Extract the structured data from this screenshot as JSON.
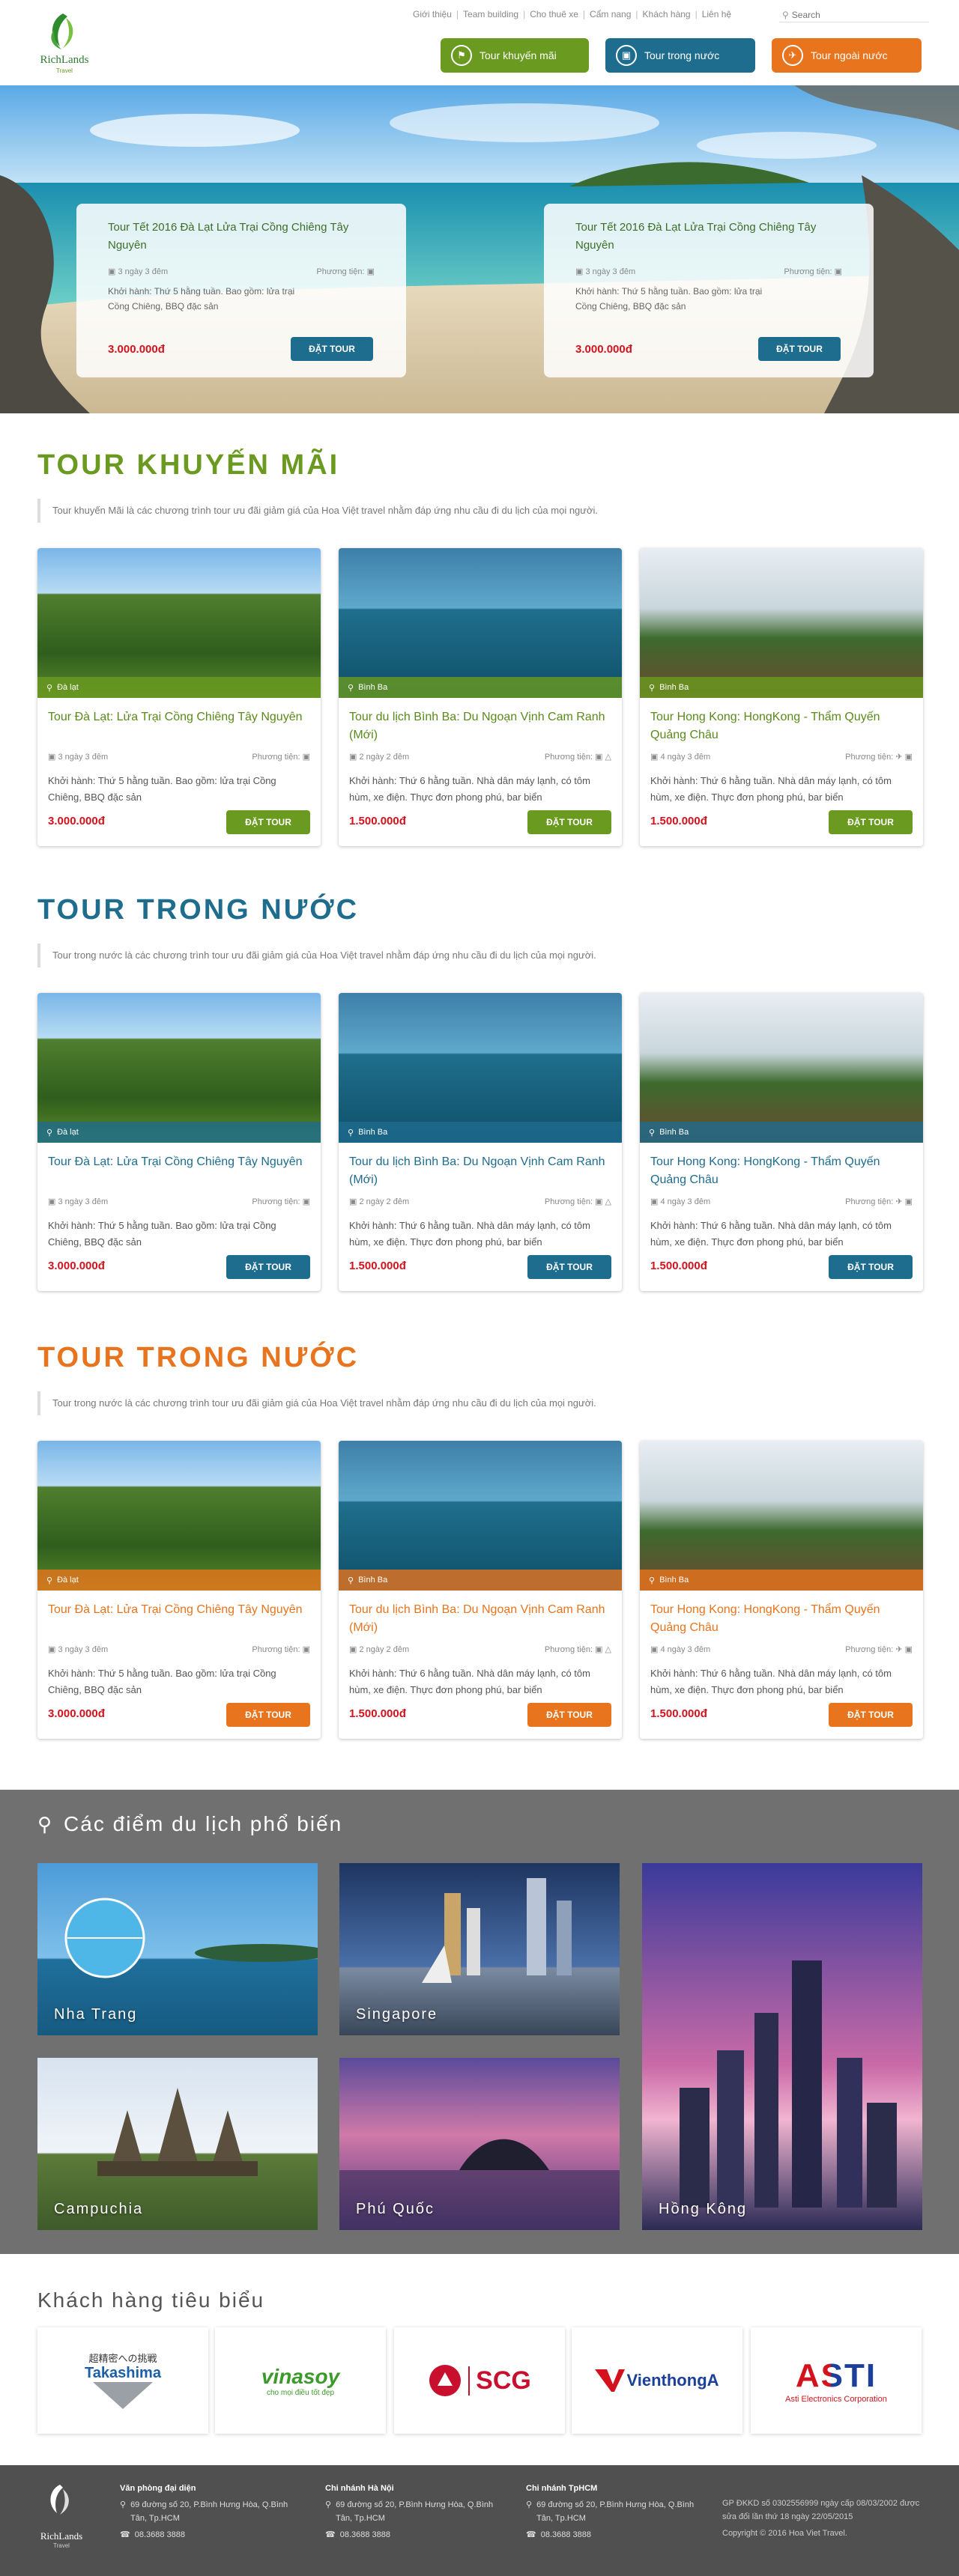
{
  "brand": {
    "name": "RichLands",
    "sub": "Travel",
    "color": "#3a8a2c"
  },
  "topnav": {
    "links": [
      "Giới thiệu",
      "Team building",
      "Cho thuê xe",
      "Cẩm nang",
      "Khách hàng",
      "Liên hệ"
    ],
    "search_placeholder": "Search"
  },
  "mainnav": [
    {
      "label": "Tour khuyến mãi",
      "color": "#6a9a1f",
      "icon": "tag-icon"
    },
    {
      "label": "Tour trong nước",
      "color": "#1e6c8e",
      "icon": "bus-icon"
    },
    {
      "label": "Tour ngoài nước",
      "color": "#e8741d",
      "icon": "plane-icon"
    }
  ],
  "hero": {
    "cards": [
      {
        "title": "Tour Tết 2016 Đà Lạt Lửa Trại Cồng Chiêng Tây Nguyên",
        "duration": "3 ngày 3 đêm",
        "transport": "Phương tiện:",
        "desc": "Khởi hành: Thứ 5 hằng tuần. Bao gồm: lửa trại Cồng Chiêng, BBQ đặc sản",
        "price": "3.000.000đ",
        "button": "ĐẶT TOUR"
      },
      {
        "title": "Tour Tết 2016 Đà Lạt Lửa Trại Cồng Chiêng Tây Nguyên",
        "duration": "3 ngày 3 đêm",
        "transport": "Phương tiện:",
        "desc": "Khởi hành: Thứ 5 hằng tuần. Bao gồm: lửa trại Cồng Chiêng, BBQ đặc sản",
        "price": "3.000.000đ",
        "button": "ĐẶT TOUR"
      }
    ]
  },
  "sections": [
    {
      "title": "TOUR KHUYẾN MÃI",
      "title_color": "#6a9a1f",
      "accent": "#6a9a1f",
      "title_color_card": "#5a8a1a",
      "desc": "Tour khuyến Mãi là các chương trình tour ưu đãi giảm giá của Hoa Việt travel nhằm đáp ứng nhu cầu đi du lịch của mọi người.",
      "cards": [
        {
          "location": "Đà lạt",
          "title": "Tour Đà Lạt: Lửa Trại Cồng Chiêng Tây Nguyên",
          "duration": "3 ngày 3 đêm",
          "transport": "Phương tiện:",
          "desc": "Khởi hành: Thứ 5 hằng tuần. Bao gồm: lửa trại Cồng Chiêng, BBQ đặc sản",
          "price": "3.000.000đ",
          "button": "ĐẶT TOUR"
        },
        {
          "location": "Bình Ba",
          "title": "Tour du lịch Bình Ba: Du Ngoạn Vịnh Cam Ranh (Mới)",
          "duration": "2 ngày 2 đêm",
          "transport": "Phương tiện:",
          "desc": "Khởi hành: Thứ 6 hằng tuần. Nhà dân máy lạnh, có tôm hùm, xe điện. Thực đơn phong phú, bar biển",
          "price": "1.500.000đ",
          "button": "ĐẶT TOUR"
        },
        {
          "location": "Bình Ba",
          "title": "Tour Hong Kong: HongKong - Thẩm Quyến Quảng Châu",
          "duration": "4 ngày 3 đêm",
          "transport": "Phương tiện:",
          "desc": "Khởi hành: Thứ 6 hằng tuần. Nhà dân máy lạnh, có tôm hùm, xe điện. Thực đơn phong phú, bar biển",
          "price": "1.500.000đ",
          "button": "ĐẶT TOUR"
        }
      ]
    },
    {
      "title": "TOUR TRONG NƯỚC",
      "title_color": "#1e6c8e",
      "accent": "#1e6c8e",
      "title_color_card": "#1e6c8e",
      "desc": "Tour trong nước là các chương trình tour ưu đãi giảm giá của Hoa Việt travel nhằm đáp ứng nhu cầu đi du lịch của mọi người.",
      "cards": [
        {
          "location": "Đà lạt",
          "title": "Tour Đà Lạt: Lửa Trại Cồng Chiêng Tây Nguyên",
          "duration": "3 ngày 3 đêm",
          "transport": "Phương tiện:",
          "desc": "Khởi hành: Thứ 5 hằng tuần. Bao gồm: lửa trại Cồng Chiêng, BBQ đặc sản",
          "price": "3.000.000đ",
          "button": "ĐẶT TOUR"
        },
        {
          "location": "Bình Ba",
          "title": "Tour du lịch Bình Ba: Du Ngoạn Vịnh Cam Ranh (Mới)",
          "duration": "2 ngày 2 đêm",
          "transport": "Phương tiện:",
          "desc": "Khởi hành: Thứ 6 hằng tuần. Nhà dân máy lạnh, có tôm hùm, xe điện. Thực đơn phong phú, bar biển",
          "price": "1.500.000đ",
          "button": "ĐẶT TOUR"
        },
        {
          "location": "Bình Ba",
          "title": "Tour Hong Kong: HongKong - Thẩm Quyến Quảng Châu",
          "duration": "4 ngày 3 đêm",
          "transport": "Phương tiện:",
          "desc": "Khởi hành: Thứ 6 hằng tuần. Nhà dân máy lạnh, có tôm hùm, xe điện. Thực đơn phong phú, bar biển",
          "price": "1.500.000đ",
          "button": "ĐẶT TOUR"
        }
      ]
    },
    {
      "title": "TOUR TRONG NƯỚC",
      "title_color": "#e8741d",
      "accent": "#e8741d",
      "title_color_card": "#e8741d",
      "desc": "Tour trong nước là các chương trình tour ưu đãi giảm giá của Hoa Việt travel nhằm đáp ứng nhu cầu đi du lịch của mọi người.",
      "cards": [
        {
          "location": "Đà lạt",
          "title": "Tour Đà Lạt: Lửa Trại Cồng Chiêng Tây Nguyên",
          "duration": "3 ngày 3 đêm",
          "transport": "Phương tiện:",
          "desc": "Khởi hành: Thứ 5 hằng tuần. Bao gồm: lửa trại Cồng Chiêng, BBQ đặc sản",
          "price": "3.000.000đ",
          "button": "ĐẶT TOUR"
        },
        {
          "location": "Bình Ba",
          "title": "Tour du lịch Bình Ba: Du Ngoạn Vịnh Cam Ranh (Mới)",
          "duration": "2 ngày 2 đêm",
          "transport": "Phương tiện:",
          "desc": "Khởi hành: Thứ 6 hằng tuần. Nhà dân máy lạnh, có tôm hùm, xe điện. Thực đơn phong phú, bar biển",
          "price": "1.500.000đ",
          "button": "ĐẶT TOUR"
        },
        {
          "location": "Bình Ba",
          "title": "Tour Hong Kong: HongKong - Thẩm Quyến Quảng Châu",
          "duration": "4 ngày 3 đêm",
          "transport": "Phương tiện:",
          "desc": "Khởi hành: Thứ 6 hằng tuần. Nhà dân máy lạnh, có tôm hùm, xe điện. Thực đơn phong phú, bar biển",
          "price": "1.500.000đ",
          "button": "ĐẶT TOUR"
        }
      ]
    }
  ],
  "destinations": {
    "title": "Các điểm du lịch phổ biến",
    "items": [
      "Nha Trang",
      "Singapore",
      "Hồng Kông",
      "Campuchia",
      "Phú Quốc"
    ]
  },
  "clients": {
    "title": "Khách hàng tiêu biểu",
    "items": [
      {
        "name": "Takashima",
        "tagline": "超精密への挑戦"
      },
      {
        "name": "vinasoy",
        "tagline": "cho mọi điều tốt đẹp"
      },
      {
        "name": "SCG",
        "tagline": ""
      },
      {
        "name": "VienthongA",
        "tagline": ""
      },
      {
        "name": "ASTI",
        "tagline": "Asti Electronics Corporation"
      }
    ]
  },
  "footer": {
    "cols": [
      {
        "heading": "Văn phòng đại diện",
        "address": "69 đường số 20, P.Bình Hưng Hòa, Q.Bình Tân, Tp.HCM",
        "phone": "08.3688 3888"
      },
      {
        "heading": "Chi nhánh Hà Nội",
        "address": "69 đường số 20, P.Bình Hưng Hòa, Q.Bình Tân, Tp.HCM",
        "phone": "08.3688 3888"
      },
      {
        "heading": "Chi nhánh TpHCM",
        "address": "69 đường số 20, P.Bình Hưng Hòa, Q.Bình Tân, Tp.HCM",
        "phone": "08.3688 3888"
      }
    ],
    "license": "GP ĐKKD số 0302556999 ngày cấp 08/03/2002 được sửa đổi lần thứ 18 ngày 22/05/2015",
    "copyright": "Copyright © 2016 Hoa Viet Travel."
  }
}
